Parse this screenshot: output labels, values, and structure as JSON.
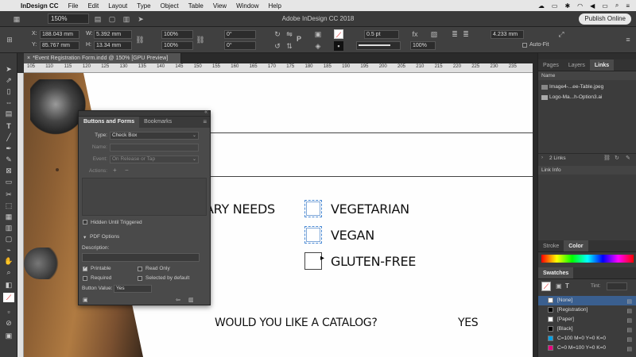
{
  "menubar": {
    "app_name": "InDesign CC",
    "items": [
      "File",
      "Edit",
      "Layout",
      "Type",
      "Object",
      "Table",
      "View",
      "Window",
      "Help"
    ]
  },
  "appbar": {
    "zoom": "150%",
    "title": "Adobe InDesign CC 2018",
    "publish": "Publish Online"
  },
  "control": {
    "x_label": "X:",
    "x_value": "188.043 mm",
    "y_label": "Y:",
    "y_value": "85.767 mm",
    "w_label": "W:",
    "w_value": "5.392 mm",
    "h_label": "H:",
    "h_value": "13.34 mm",
    "scale_x": "100%",
    "scale_y": "100%",
    "rotate": "0°",
    "shear": "0°",
    "stroke_weight": "0.5 pt",
    "opacity": "100%",
    "offset": "4.233 mm",
    "autofit": "Auto-Fit"
  },
  "document": {
    "tab_title": "*Event Registration Form.indd @ 150% [GPU Preview]"
  },
  "ruler": {
    "ticks": [
      "105",
      "110",
      "115",
      "120",
      "125",
      "130",
      "135",
      "140",
      "145",
      "150",
      "155",
      "160",
      "165",
      "170",
      "175",
      "180",
      "185",
      "190",
      "195",
      "200",
      "205",
      "210",
      "215",
      "220",
      "225",
      "230",
      "235"
    ]
  },
  "form": {
    "dietary": "ARY NEEDS",
    "opt1": "VEGETARIAN",
    "opt2": "VEGAN",
    "opt3": "GLUTEN-FREE",
    "catalog_q": "WOULD YOU LIKE A CATALOG?",
    "catalog_yes": "YES"
  },
  "bf_panel": {
    "tab1": "Buttons and Forms",
    "tab2": "Bookmarks",
    "type_label": "Type:",
    "type_value": "Check Box",
    "name_label": "Name:",
    "event_label": "Event:",
    "event_value": "On Release or Tap",
    "actions_label": "Actions:",
    "actions_add": "+",
    "actions_remove": "−",
    "hidden_label": "Hidden Until Triggered",
    "pdf_options": "PDF Options",
    "description_label": "Description:",
    "printable": "Printable",
    "read_only": "Read Only",
    "required": "Required",
    "selected_default": "Selected by default",
    "button_value_label": "Button Value:",
    "button_value": "Yes"
  },
  "right_panel": {
    "tabs": [
      "Pages",
      "Layers",
      "Links"
    ],
    "name_header": "Name",
    "links": [
      "Image4-...ee-Table.jpeg",
      "Logo-Ma...h-Option3.ai"
    ],
    "links_count": "2 Links",
    "link_info": "Link Info",
    "stroke_tab": "Stroke",
    "color_tab": "Color",
    "swatches_tab": "Swatches",
    "tint_label": "Tint:",
    "swatches": [
      {
        "name": "[None]",
        "color": "#ffffff"
      },
      {
        "name": "[Registration]",
        "color": "#000000"
      },
      {
        "name": "[Paper]",
        "color": "#ffffff"
      },
      {
        "name": "[Black]",
        "color": "#000000"
      },
      {
        "name": "C=100 M=0 Y=0 K=0",
        "color": "#00a0e3"
      },
      {
        "name": "C=0 M=100 Y=0 K=0",
        "color": "#e6007e"
      }
    ]
  }
}
